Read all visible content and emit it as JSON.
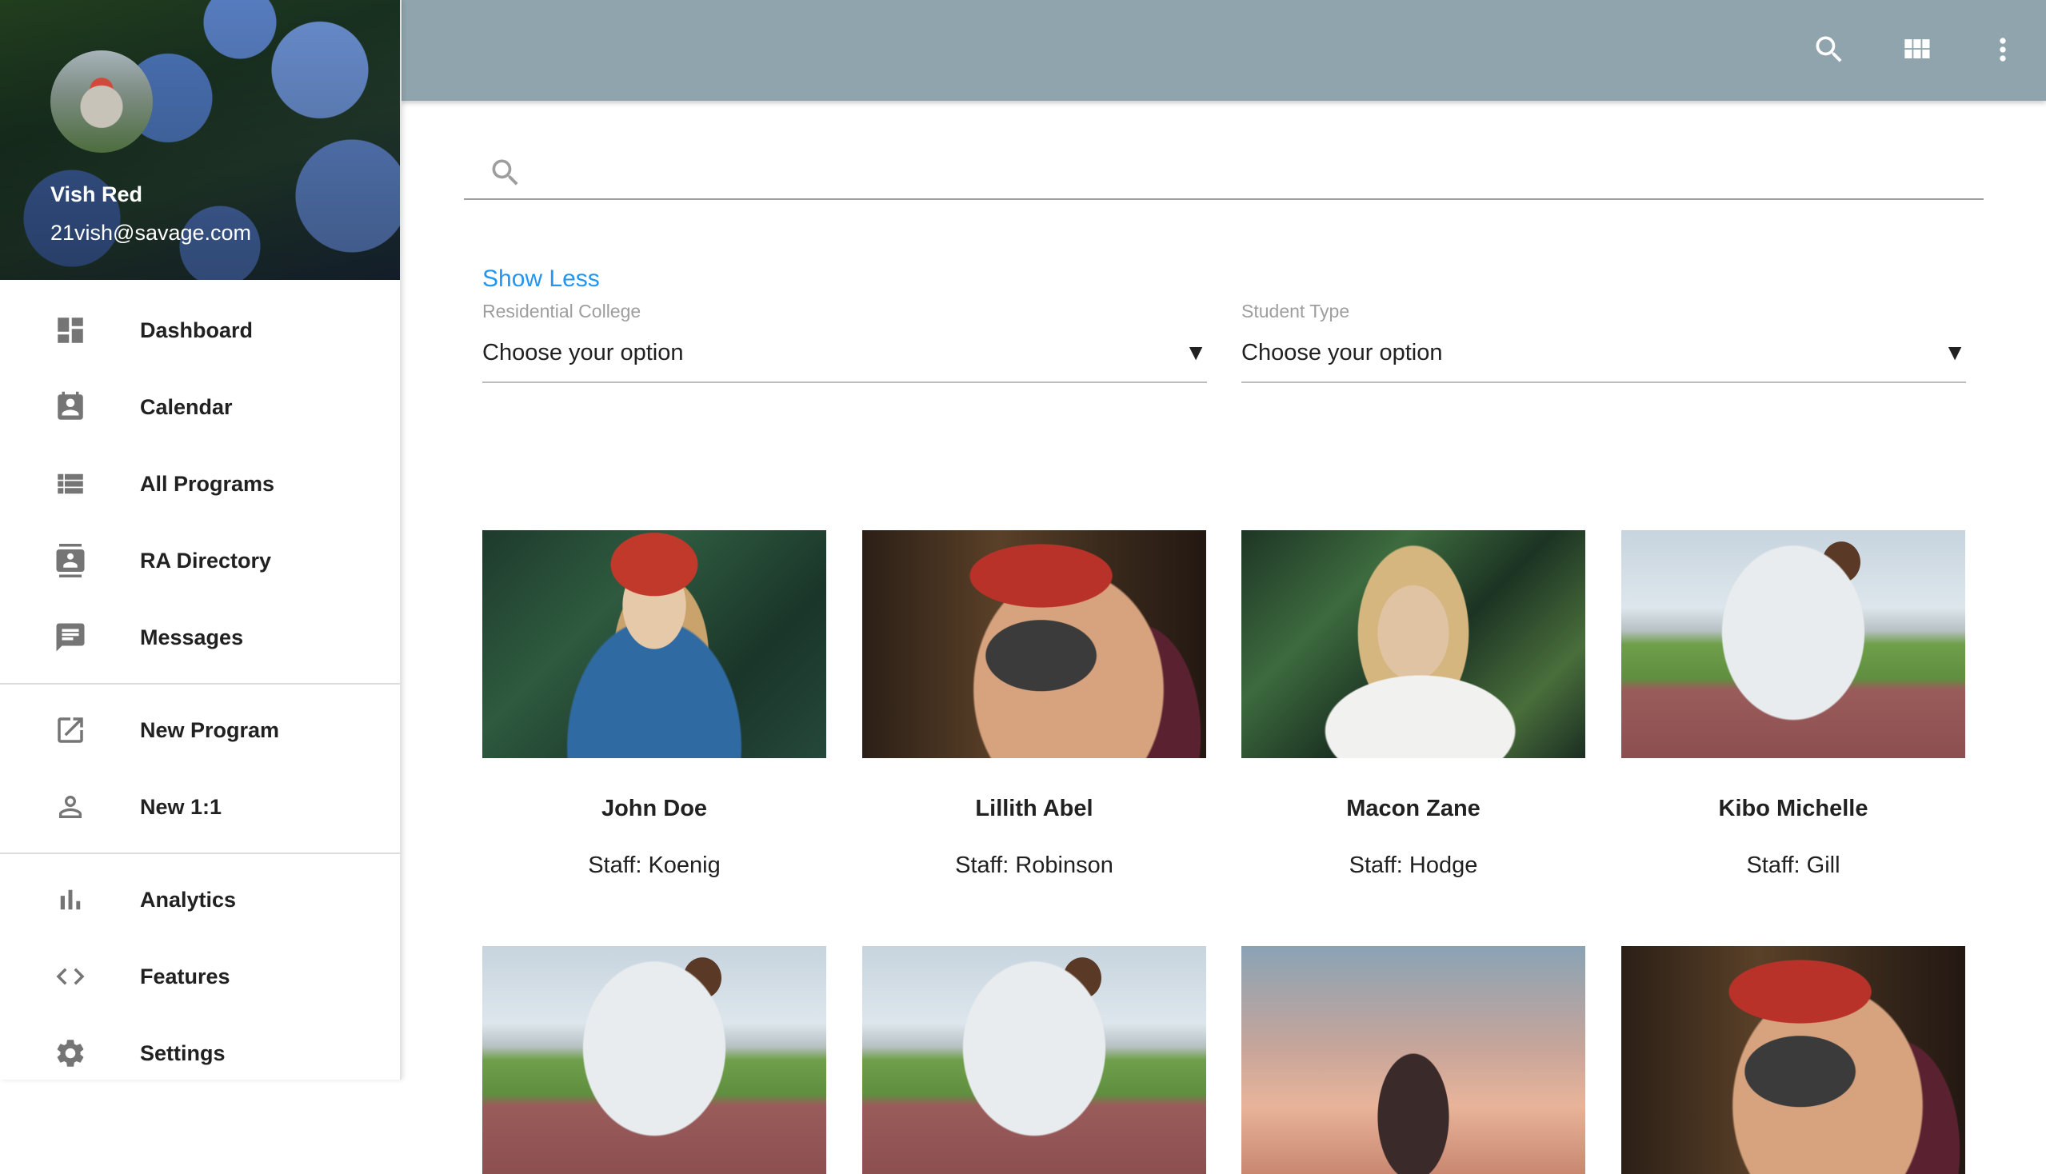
{
  "user": {
    "name": "Vish Red",
    "email": "21vish@savage.com"
  },
  "sidebar": {
    "groups": [
      [
        {
          "label": "Dashboard",
          "icon": "dashboard-icon"
        },
        {
          "label": "Calendar",
          "icon": "calendar-icon"
        },
        {
          "label": "All Programs",
          "icon": "list-icon"
        },
        {
          "label": "RA Directory",
          "icon": "contacts-icon"
        },
        {
          "label": "Messages",
          "icon": "message-icon"
        }
      ],
      [
        {
          "label": "New Program",
          "icon": "open-in-new-icon"
        },
        {
          "label": "New 1:1",
          "icon": "person-icon"
        }
      ],
      [
        {
          "label": "Analytics",
          "icon": "bar-chart-icon"
        },
        {
          "label": "Features",
          "icon": "code-icon"
        },
        {
          "label": "Settings",
          "icon": "gear-icon"
        }
      ]
    ]
  },
  "topbar": {
    "icons": [
      "search-icon",
      "apps-grid-icon",
      "more-vert-icon"
    ],
    "color": "#90a4ae"
  },
  "search": {
    "value": "",
    "placeholder": ""
  },
  "filters": {
    "toggle_label": "Show Less",
    "residential_college": {
      "label": "Residential College",
      "value": "Choose your option"
    },
    "student_type": {
      "label": "Student Type",
      "value": "Choose your option"
    },
    "caret": "▼"
  },
  "cards": [
    {
      "name": "John Doe",
      "staff": "Staff: Koenig",
      "photo": "forest"
    },
    {
      "name": "Lillith Abel",
      "staff": "Staff: Robinson",
      "photo": "camera-red"
    },
    {
      "name": "Macon Zane",
      "staff": "Staff: Hodge",
      "photo": "plants"
    },
    {
      "name": "Kibo Michelle",
      "staff": "Staff: Gill",
      "photo": "runner"
    },
    {
      "name": "",
      "staff": "",
      "photo": "runner"
    },
    {
      "name": "",
      "staff": "",
      "photo": "runner"
    },
    {
      "name": "",
      "staff": "",
      "photo": "sunset"
    },
    {
      "name": "",
      "staff": "",
      "photo": "camera-red"
    }
  ],
  "colors": {
    "accent": "#2196f3",
    "icon_gray": "#757575"
  }
}
